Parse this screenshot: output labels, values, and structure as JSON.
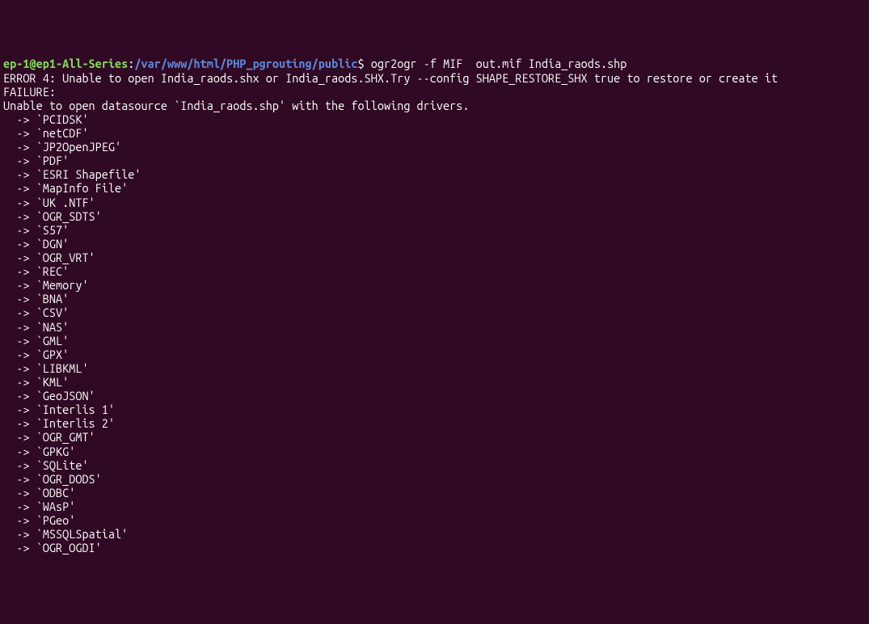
{
  "prompt": {
    "user_host": "ep-1@ep1-All-Series",
    "separator": ":",
    "path": "/var/www/html/PHP_pgrouting/public",
    "dollar": "$"
  },
  "command": " ogr2ogr -f MIF  out.mif India_raods.shp",
  "error_line": "ERROR 4: Unable to open India_raods.shx or India_raods.SHX.Try --config SHAPE_RESTORE_SHX true to restore or create it",
  "failure_line": "FAILURE:",
  "unable_line": "Unable to open datasource `India_raods.shp' with the following drivers.",
  "drivers": [
    "  -> `PCIDSK'",
    "  -> `netCDF'",
    "  -> `JP2OpenJPEG'",
    "  -> `PDF'",
    "  -> `ESRI Shapefile'",
    "  -> `MapInfo File'",
    "  -> `UK .NTF'",
    "  -> `OGR_SDTS'",
    "  -> `S57'",
    "  -> `DGN'",
    "  -> `OGR_VRT'",
    "  -> `REC'",
    "  -> `Memory'",
    "  -> `BNA'",
    "  -> `CSV'",
    "  -> `NAS'",
    "  -> `GML'",
    "  -> `GPX'",
    "  -> `LIBKML'",
    "  -> `KML'",
    "  -> `GeoJSON'",
    "  -> `Interlis 1'",
    "  -> `Interlis 2'",
    "  -> `OGR_GMT'",
    "  -> `GPKG'",
    "  -> `SQLite'",
    "  -> `OGR_DODS'",
    "  -> `ODBC'",
    "  -> `WAsP'",
    "  -> `PGeo'",
    "  -> `MSSQLSpatial'",
    "  -> `OGR_OGDI'"
  ]
}
